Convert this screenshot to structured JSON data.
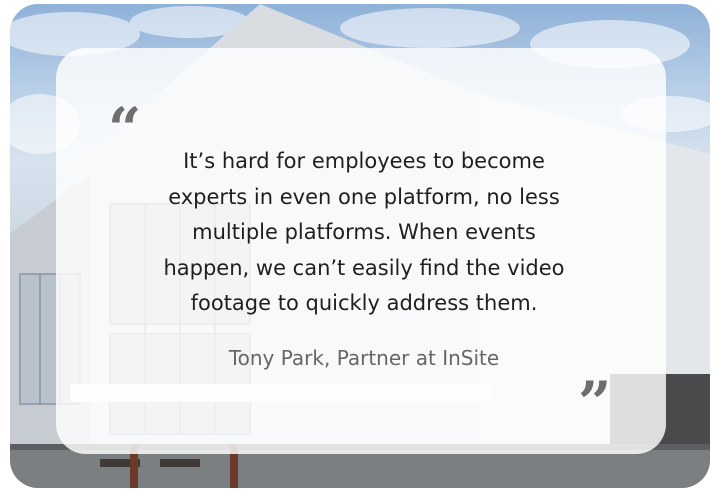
{
  "testimonial": {
    "quote_open": "“",
    "quote_close": "”",
    "quote_lines": [
      "It’s hard for employees to become",
      "experts in even one platform, no less",
      "multiple platforms. When events",
      "happen, we can’t easily find the video",
      "footage to quickly address them."
    ],
    "attribution": "Tony Park, Partner at InSite"
  },
  "colors": {
    "card_background": "#ffffff",
    "quote_text": "#1f1f1f",
    "attribution_text": "#666666",
    "quote_marks": "#6e6e6e"
  }
}
